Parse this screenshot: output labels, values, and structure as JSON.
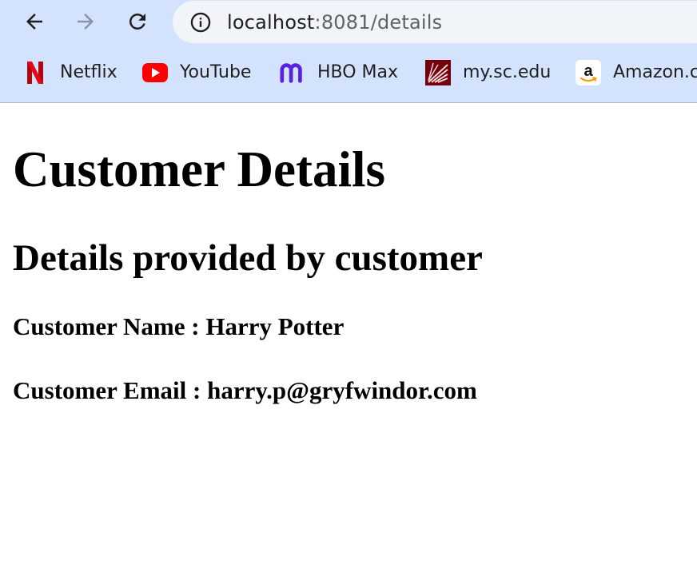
{
  "browser": {
    "url_host": "localhost",
    "url_path": ":8081/details",
    "bookmarks": [
      {
        "label": "Netflix",
        "icon": "netflix-icon",
        "color": "#e50914"
      },
      {
        "label": "YouTube",
        "icon": "youtube-icon",
        "color": "#ff0000"
      },
      {
        "label": "HBO Max",
        "icon": "hbo-max-icon",
        "color": "#5822e0"
      },
      {
        "label": "my.sc.edu",
        "icon": "mysc-icon",
        "color": "#73000a"
      },
      {
        "label": "Amazon.c",
        "icon": "amazon-icon",
        "color": "#ff9900"
      }
    ]
  },
  "page": {
    "title": "Customer Details",
    "subtitle": "Details provided by customer",
    "details": {
      "name_line": "Customer Name : Harry Potter",
      "email_line": "Customer Email : harry.p@gryfwindor.com"
    }
  }
}
